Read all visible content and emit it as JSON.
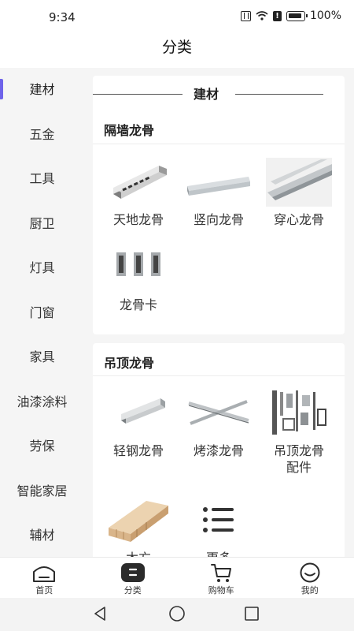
{
  "status": {
    "time": "9:34",
    "battery": "100%"
  },
  "header": {
    "title": "分类"
  },
  "sidebar": {
    "items": [
      {
        "label": "建材"
      },
      {
        "label": "五金"
      },
      {
        "label": "工具"
      },
      {
        "label": "厨卫"
      },
      {
        "label": "灯具"
      },
      {
        "label": "门窗"
      },
      {
        "label": "家具"
      },
      {
        "label": "油漆涂料"
      },
      {
        "label": "劳保"
      },
      {
        "label": "智能家居"
      },
      {
        "label": "辅材"
      }
    ],
    "active": "建材"
  },
  "content": {
    "category_title": "建材",
    "sections": [
      {
        "title": "隔墙龙骨",
        "items": [
          {
            "label": "天地龙骨",
            "icon": "channel-rail-image"
          },
          {
            "label": "竖向龙骨",
            "icon": "stud-rail-image"
          },
          {
            "label": "穿心龙骨",
            "icon": "carrying-rail-image"
          },
          {
            "label": "龙骨卡",
            "icon": "clip-image"
          }
        ]
      },
      {
        "title": "吊顶龙骨",
        "items": [
          {
            "label": "轻钢龙骨",
            "icon": "light-steel-rail-image"
          },
          {
            "label": "烤漆龙骨",
            "icon": "painted-tee-rail-image"
          },
          {
            "label": "吊顶龙骨配件",
            "label_line1": "吊顶龙骨",
            "label_line2": "配件",
            "icon": "ceiling-accessories-image"
          },
          {
            "label": "木方",
            "icon": "timber-image"
          },
          {
            "label": "更多",
            "icon": "list-icon"
          }
        ]
      }
    ]
  },
  "tabbar": {
    "tabs": [
      {
        "label": "首页",
        "icon": "home-icon"
      },
      {
        "label": "分类",
        "icon": "category-icon",
        "active": true
      },
      {
        "label": "购物车",
        "icon": "cart-icon"
      },
      {
        "label": "我的",
        "icon": "profile-icon"
      }
    ]
  },
  "colors": {
    "accent": "#6e63ea",
    "background": "#f5f5f5",
    "dark": "#2b2b2b"
  }
}
